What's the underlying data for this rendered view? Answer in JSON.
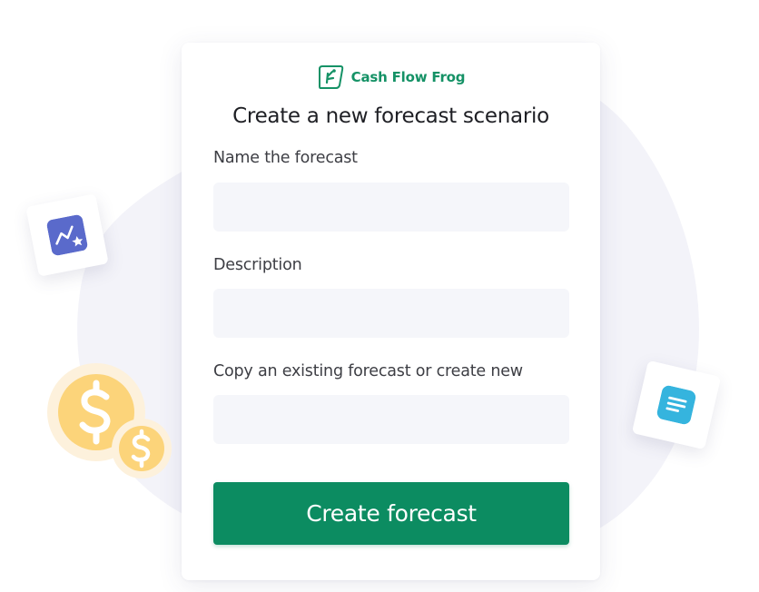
{
  "brand": {
    "name": "Cash Flow Frog",
    "color": "#159266"
  },
  "form": {
    "title": "Create a new forecast scenario",
    "fields": [
      {
        "label": "Name the forecast",
        "value": "",
        "placeholder": ""
      },
      {
        "label": "Description",
        "value": "",
        "placeholder": ""
      },
      {
        "label": "Copy an existing forecast or create new",
        "value": "",
        "placeholder": ""
      }
    ],
    "submit_label": "Create forecast"
  },
  "decor": {
    "icons": [
      "trend-chart-icon",
      "document-icon",
      "dollar-coin-icon"
    ],
    "colors": {
      "primary_green": "#0c8c61",
      "field_background": "#f5f6fa",
      "chart_icon": "#5a6acb",
      "document_icon": "#35b4de",
      "coin": "#fcd47a",
      "coin_glow": "#fdf1dc",
      "blob": "#f3f3f9"
    }
  }
}
